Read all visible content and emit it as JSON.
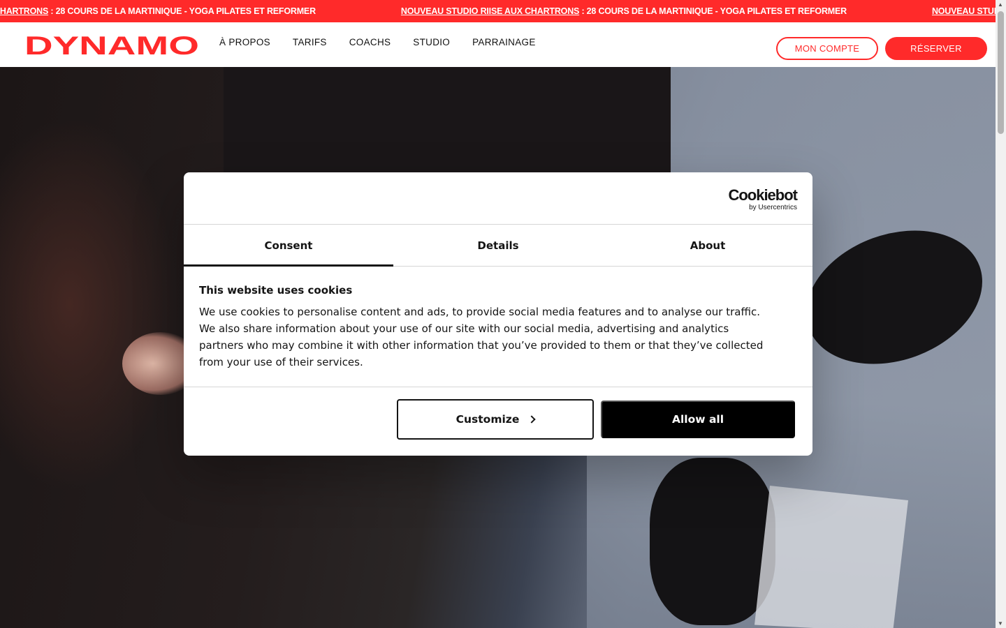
{
  "ticker": {
    "items": [
      {
        "link": "AUX CHARTRONS",
        "text": " : 28 COURS DE LA MARTINIQUE - YOGA PILATES ET REFORMER"
      },
      {
        "link": "NOUVEAU STUDIO RIISE AUX CHARTRONS",
        "text": " : 28 COURS DE LA MARTINIQUE - YOGA PILATES ET REFORMER"
      },
      {
        "link": "NOUVEAU STUDIO R",
        "text": ""
      }
    ]
  },
  "nav": {
    "logo": "DYNAMO",
    "links": [
      "À PROPOS",
      "TARIFS",
      "COACHS",
      "STUDIO",
      "PARRAINAGE"
    ],
    "account_label": "MON COMPTE",
    "reserve_label": "RÉSERVER"
  },
  "cookie_dialog": {
    "brand": "Cookiebot",
    "brand_sub": "by Usercentrics",
    "tabs": [
      "Consent",
      "Details",
      "About"
    ],
    "active_tab": "Consent",
    "title": "This website uses cookies",
    "text": "We use cookies to personalise content and ads, to provide social media features and to analyse our traffic. We also share information about your use of our site with our social media, advertising and analytics partners who may combine it with other information that you’ve provided to them or that they’ve collected from your use of their services.",
    "customize_label": "Customize",
    "allow_label": "Allow all"
  },
  "colors": {
    "brand_red": "#ff2a2a",
    "dialog_text": "#141414"
  }
}
